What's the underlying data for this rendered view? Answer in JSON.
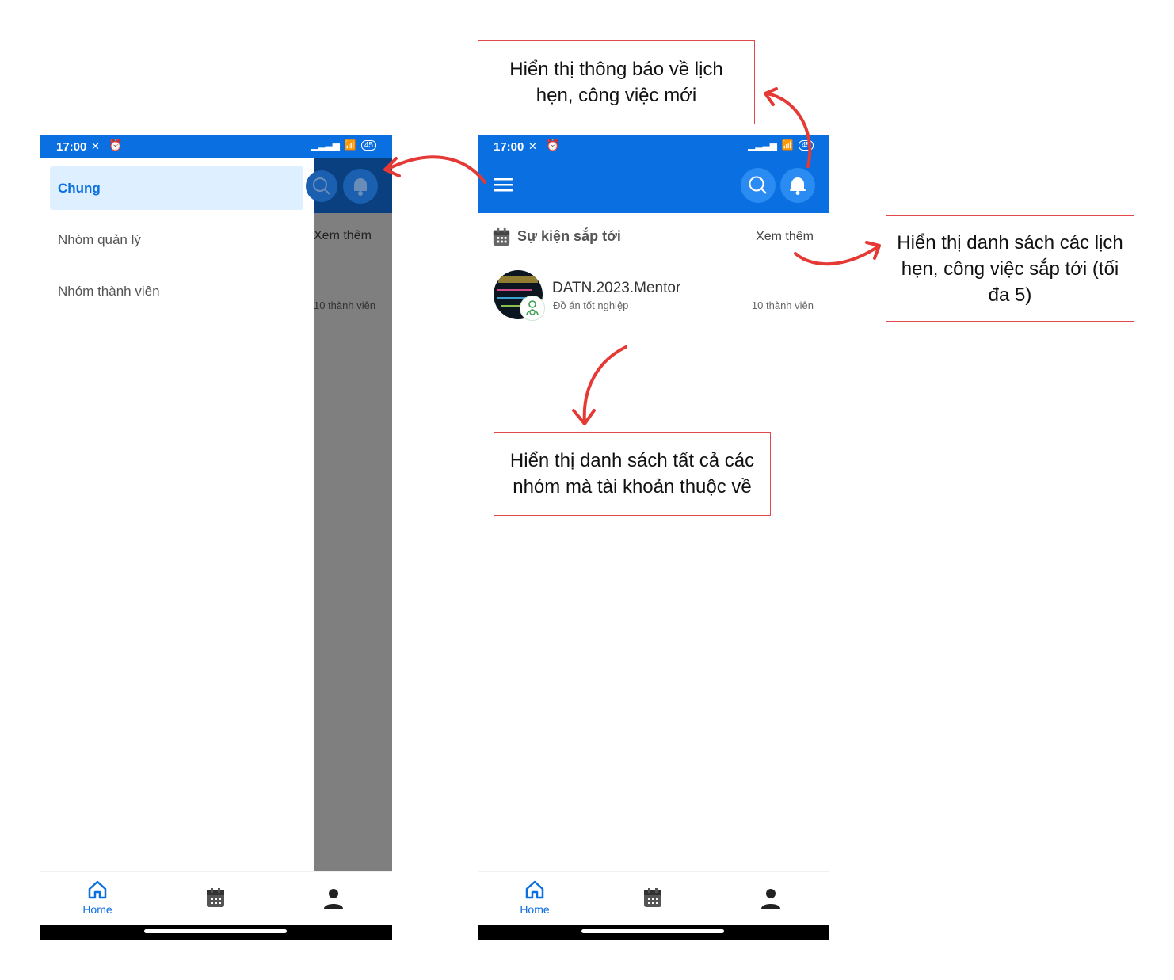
{
  "status_bar": {
    "time": "17:00",
    "battery": "45"
  },
  "left_screen": {
    "drawer": {
      "items": [
        "Chung",
        "Nhóm quản lý",
        "Nhóm thành viên"
      ],
      "active_index": 0
    },
    "behind": {
      "see_more": "Xem thêm",
      "members": "10 thành viên"
    }
  },
  "right_screen": {
    "section_title": "Sự kiện sắp tới",
    "see_more": "Xem thêm",
    "group": {
      "name": "DATN.2023.Mentor",
      "description": "Đồ án tốt nghiệp",
      "members": "10 thành viên"
    }
  },
  "bottom_nav": {
    "home_label": "Home"
  },
  "icons": [
    "menu-icon",
    "search-icon",
    "bell-icon",
    "calendar-icon",
    "home-icon",
    "user-icon",
    "signal-icon",
    "wifi-icon",
    "battery-icon",
    "alarm-icon",
    "mute-icon"
  ],
  "colors": {
    "primary": "#0a6fe0",
    "active_bg": "#deefff",
    "callout_border": "#e2474a",
    "arrow": "#e53935"
  },
  "callouts": {
    "notifications": "Hiển thị thông báo về lịch hẹn, công việc mới",
    "upcoming": "Hiển thị danh sách các lịch hẹn, công việc sắp tới (tối đa 5)",
    "groups": "Hiển thị danh sách tất cả các nhóm mà tài khoản thuộc về"
  }
}
